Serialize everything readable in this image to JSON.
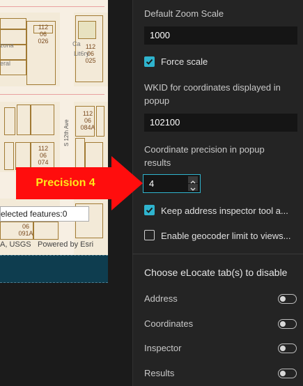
{
  "map": {
    "lots": [
      {
        "label": "112\n06\n026"
      },
      {
        "label": "112\n06\n025"
      },
      {
        "label": "112\n06\n084A"
      },
      {
        "label": "112\n06\n074"
      },
      {
        "label": "06\n091A"
      }
    ],
    "street_label": "S 12th Ave",
    "partial_labels": [
      "zona",
      "eral",
      "Ca",
      "Lit6ry"
    ],
    "selected_features": "elected features:0",
    "attribution_left": "A, USGS",
    "attribution_right": "Powered by Esri"
  },
  "callout": {
    "text": "Precision 4",
    "color": "#ff0d0d",
    "text_color": "#ffe81a"
  },
  "panel": {
    "default_zoom_label": "Default Zoom Scale",
    "default_zoom_value": "1000",
    "force_scale_label": "Force scale",
    "force_scale_checked": true,
    "wkid_label_line1": "WKID for coordinates displayed in",
    "wkid_label_line2": "popup",
    "wkid_value": "102100",
    "precision_label_line1": "Coordinate precision in popup",
    "precision_label_line2": "results",
    "precision_value": "4",
    "keep_inspector_label": "Keep address inspector tool a...",
    "keep_inspector_checked": true,
    "geocoder_limit_label": "Enable geocoder limit to views...",
    "geocoder_limit_checked": false,
    "disable_tabs_heading": "Choose eLocate tab(s) to disable",
    "tabs": [
      {
        "label": "Address",
        "enabled": false
      },
      {
        "label": "Coordinates",
        "enabled": false
      },
      {
        "label": "Inspector",
        "enabled": false
      },
      {
        "label": "Results",
        "enabled": false
      }
    ],
    "accent_color": "#2fb4ce"
  }
}
